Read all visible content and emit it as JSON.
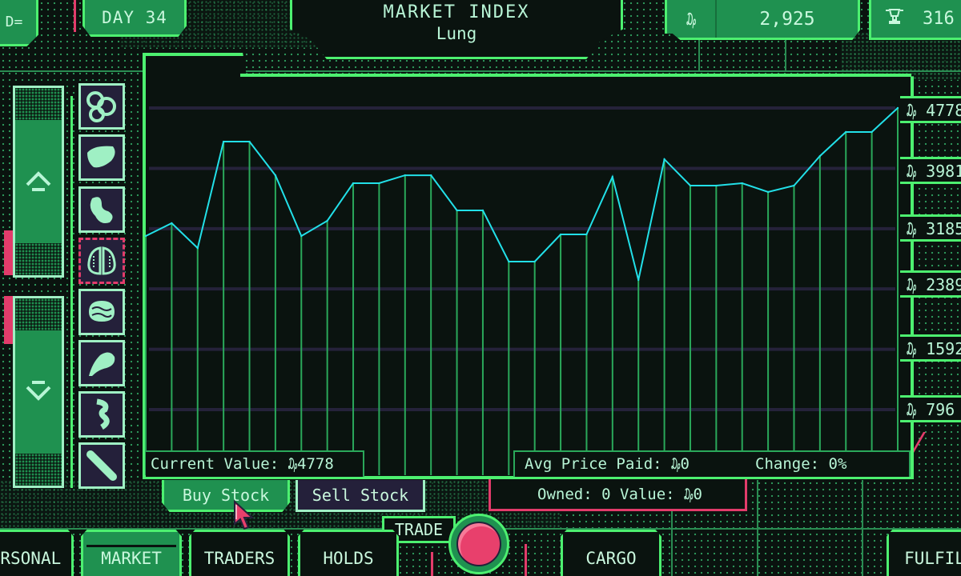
{
  "header": {
    "day_label": "DAY 34",
    "left_badge_icon": "stock-ticker-icon",
    "left_badge_text": "D=",
    "title": "MARKET INDEX",
    "subtitle": "Lung",
    "currency_icon": "credit-icon",
    "currency_glyph": "₯",
    "money": "2,925",
    "trophy_icon": "trophy-icon",
    "trophy_glyph": "🏆",
    "trophy_value": "316"
  },
  "organs": [
    {
      "name": "intestines",
      "selected": false
    },
    {
      "name": "liver",
      "selected": false
    },
    {
      "name": "kidney",
      "selected": false
    },
    {
      "name": "lung",
      "selected": true
    },
    {
      "name": "brain",
      "selected": false
    },
    {
      "name": "stomach",
      "selected": false
    },
    {
      "name": "spine",
      "selected": false
    },
    {
      "name": "bone",
      "selected": false
    }
  ],
  "sliders": {
    "up_label": "scroll-up",
    "down_label": "scroll-down"
  },
  "stats": {
    "current_value": "Current Value: ₯4778",
    "avg_price": "Avg Price Paid: ₯0",
    "change": "Change: 0%",
    "owned": "Owned: 0 Value: ₯0"
  },
  "actions": {
    "buy": "Buy Stock",
    "sell": "Sell Stock",
    "trade": "TRADE"
  },
  "tabs": [
    {
      "label": "ERSONAL",
      "active": false
    },
    {
      "label": "MARKET",
      "active": true
    },
    {
      "label": "TRADERS",
      "active": false
    },
    {
      "label": "HOLDS",
      "active": false
    },
    {
      "label": "CARGO",
      "active": false
    },
    {
      "label": "FULFIL",
      "active": false
    }
  ],
  "colors": {
    "line": "#22e0e8",
    "frame": "#4df070",
    "accent_pink": "#e23c6b",
    "panel_green": "#1f9150"
  },
  "chart_data": {
    "type": "line",
    "title": "MARKET INDEX",
    "subtitle": "Lung",
    "xlabel": "",
    "ylabel": "",
    "ylim": [
      796,
      4778
    ],
    "ytick_labels": [
      "₯ 4778",
      "₯ 3981",
      "₯ 3185",
      "₯ 2389",
      "₯ 1592",
      "₯ 796"
    ],
    "yticks": [
      4778,
      3981,
      3185,
      2389,
      1592,
      796
    ],
    "grid": true,
    "legend": "none",
    "series": [
      {
        "name": "Lung",
        "values": [
          3088,
          3257,
          2929,
          4334,
          4334,
          3890,
          3088,
          3289,
          3785,
          3785,
          3890,
          3890,
          3426,
          3426,
          2750,
          2750,
          3109,
          3109,
          3869,
          2507,
          4101,
          3753,
          3753,
          3785,
          3669,
          3753,
          4144,
          4461,
          4461,
          4778
        ]
      }
    ]
  }
}
